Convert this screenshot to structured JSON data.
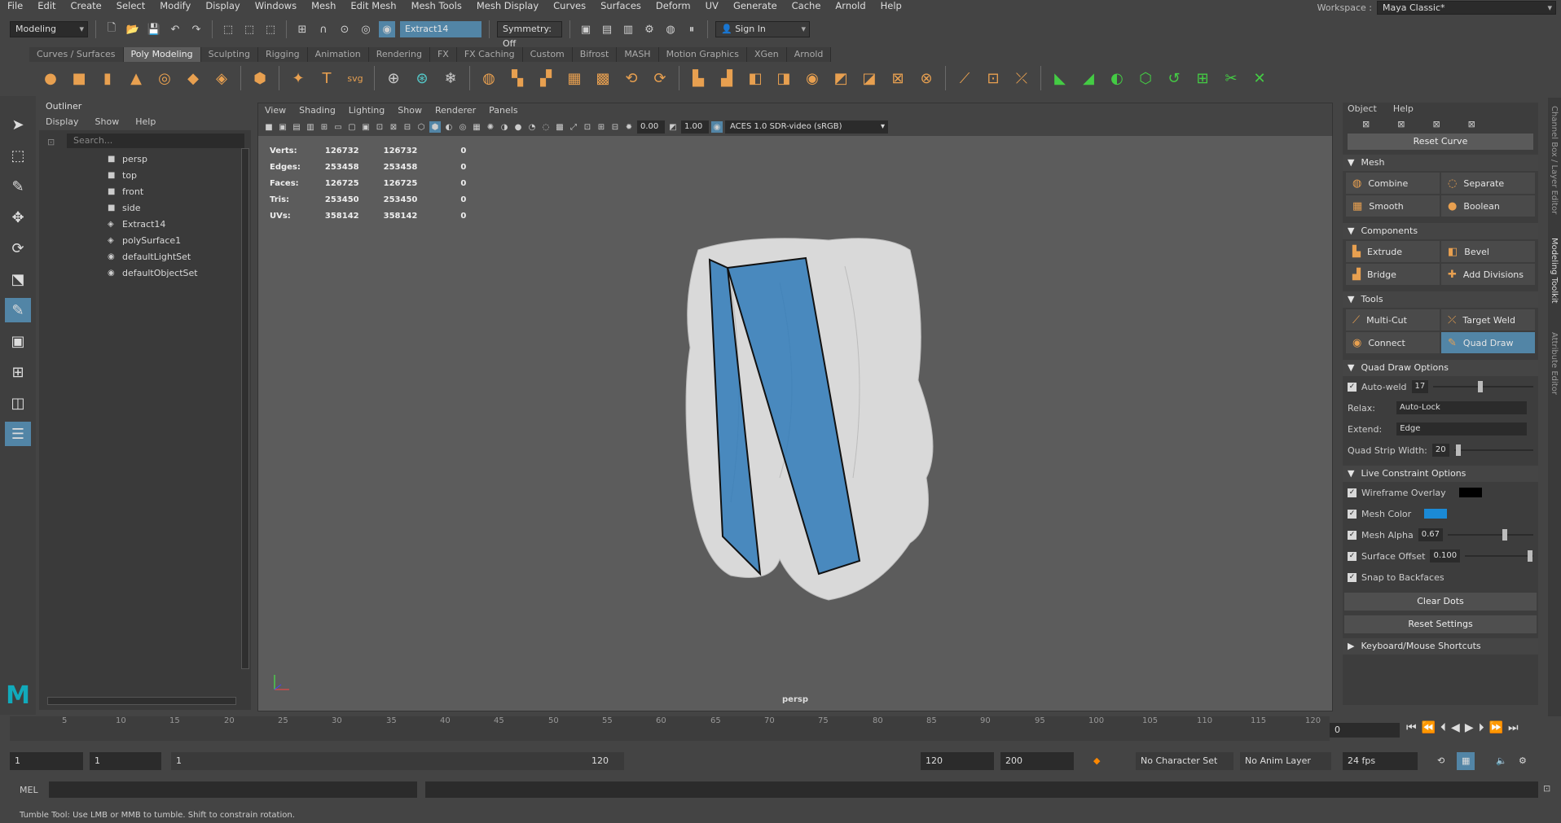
{
  "menu": [
    "File",
    "Edit",
    "Create",
    "Select",
    "Modify",
    "Display",
    "Windows",
    "Mesh",
    "Edit Mesh",
    "Mesh Tools",
    "Mesh Display",
    "Curves",
    "Surfaces",
    "Deform",
    "UV",
    "Generate",
    "Cache",
    "Arnold",
    "Help"
  ],
  "workspace": {
    "label": "Workspace :",
    "value": "Maya Classic*"
  },
  "toolbar": {
    "mode": "Modeling",
    "object_field": "Extract14",
    "symmetry": "Symmetry: Off",
    "sign_in": "Sign In"
  },
  "shelf_tabs": [
    "Curves / Surfaces",
    "Poly Modeling",
    "Sculpting",
    "Rigging",
    "Animation",
    "Rendering",
    "FX",
    "FX Caching",
    "Custom",
    "Bifrost",
    "MASH",
    "Motion Graphics",
    "XGen",
    "Arnold"
  ],
  "active_shelf_tab": "Poly Modeling",
  "outliner": {
    "title": "Outliner",
    "menu": [
      "Display",
      "Show",
      "Help"
    ],
    "search_placeholder": "Search...",
    "items": [
      {
        "label": "persp",
        "icon": "camera-icon"
      },
      {
        "label": "top",
        "icon": "camera-icon"
      },
      {
        "label": "front",
        "icon": "camera-icon"
      },
      {
        "label": "side",
        "icon": "camera-icon"
      },
      {
        "label": "Extract14",
        "icon": "mesh-icon"
      },
      {
        "label": "polySurface1",
        "icon": "mesh-icon"
      },
      {
        "label": "defaultLightSet",
        "icon": "set-icon"
      },
      {
        "label": "defaultObjectSet",
        "icon": "set-icon"
      }
    ]
  },
  "viewport": {
    "menu": [
      "View",
      "Shading",
      "Lighting",
      "Show",
      "Renderer",
      "Panels"
    ],
    "exposure": "0.00",
    "gamma": "1.00",
    "colorspace": "ACES 1.0 SDR-video (sRGB)",
    "camera": "persp",
    "hud": [
      {
        "label": "Verts:",
        "a": "126732",
        "b": "126732",
        "c": "0"
      },
      {
        "label": "Edges:",
        "a": "253458",
        "b": "253458",
        "c": "0"
      },
      {
        "label": "Faces:",
        "a": "126725",
        "b": "126725",
        "c": "0"
      },
      {
        "label": "Tris:",
        "a": "253450",
        "b": "253450",
        "c": "0"
      },
      {
        "label": "UVs:",
        "a": "358142",
        "b": "358142",
        "c": "0"
      }
    ]
  },
  "toolkit": {
    "menu": [
      "Object",
      "Help"
    ],
    "reset_curve": "Reset Curve",
    "mesh_title": "Mesh",
    "mesh_buttons": [
      "Combine",
      "Separate",
      "Smooth",
      "Boolean"
    ],
    "components_title": "Components",
    "components_buttons": [
      "Extrude",
      "Bevel",
      "Bridge",
      "Add Divisions"
    ],
    "tools_title": "Tools",
    "tools_buttons": [
      "Multi-Cut",
      "Target Weld",
      "Connect",
      "Quad Draw"
    ],
    "active_tool": "Quad Draw",
    "qd_title": "Quad Draw Options",
    "autoweld_label": "Auto-weld",
    "autoweld_value": "17",
    "relax_label": "Relax:",
    "relax_value": "Auto-Lock",
    "extend_label": "Extend:",
    "extend_value": "Edge",
    "strip_label": "Quad Strip Width:",
    "strip_value": "20",
    "lc_title": "Live Constraint Options",
    "wire_label": "Wireframe Overlay",
    "meshcolor_label": "Mesh Color",
    "meshalpha_label": "Mesh Alpha",
    "meshalpha_value": "0.67",
    "surfoff_label": "Surface Offset",
    "surfoff_value": "0.100",
    "snap_label": "Snap to Backfaces",
    "clear_dots": "Clear Dots",
    "reset_settings": "Reset Settings",
    "shortcuts": "Keyboard/Mouse Shortcuts",
    "mesh_color": "#1b8ad6",
    "wire_color": "#000000"
  },
  "side_tabs": [
    "Channel Box / Layer Editor",
    "Modeling Toolkit",
    "Attribute Editor"
  ],
  "timeline": {
    "ticks": [
      "5",
      "10",
      "15",
      "20",
      "25",
      "30",
      "35",
      "40",
      "45",
      "50",
      "55",
      "60",
      "65",
      "70",
      "75",
      "80",
      "85",
      "90",
      "95",
      "100",
      "105",
      "110",
      "115",
      "120"
    ],
    "current": "0"
  },
  "range": {
    "start": "1",
    "start2": "1",
    "slider_start": "1",
    "slider_end": "120",
    "end": "120",
    "end2": "200",
    "char_set": "No Character Set",
    "anim_layer": "No Anim Layer",
    "fps": "24 fps"
  },
  "mel_label": "MEL",
  "status": "Tumble Tool: Use LMB or MMB to tumble. Shift to constrain rotation.",
  "accent": "#5285a6"
}
